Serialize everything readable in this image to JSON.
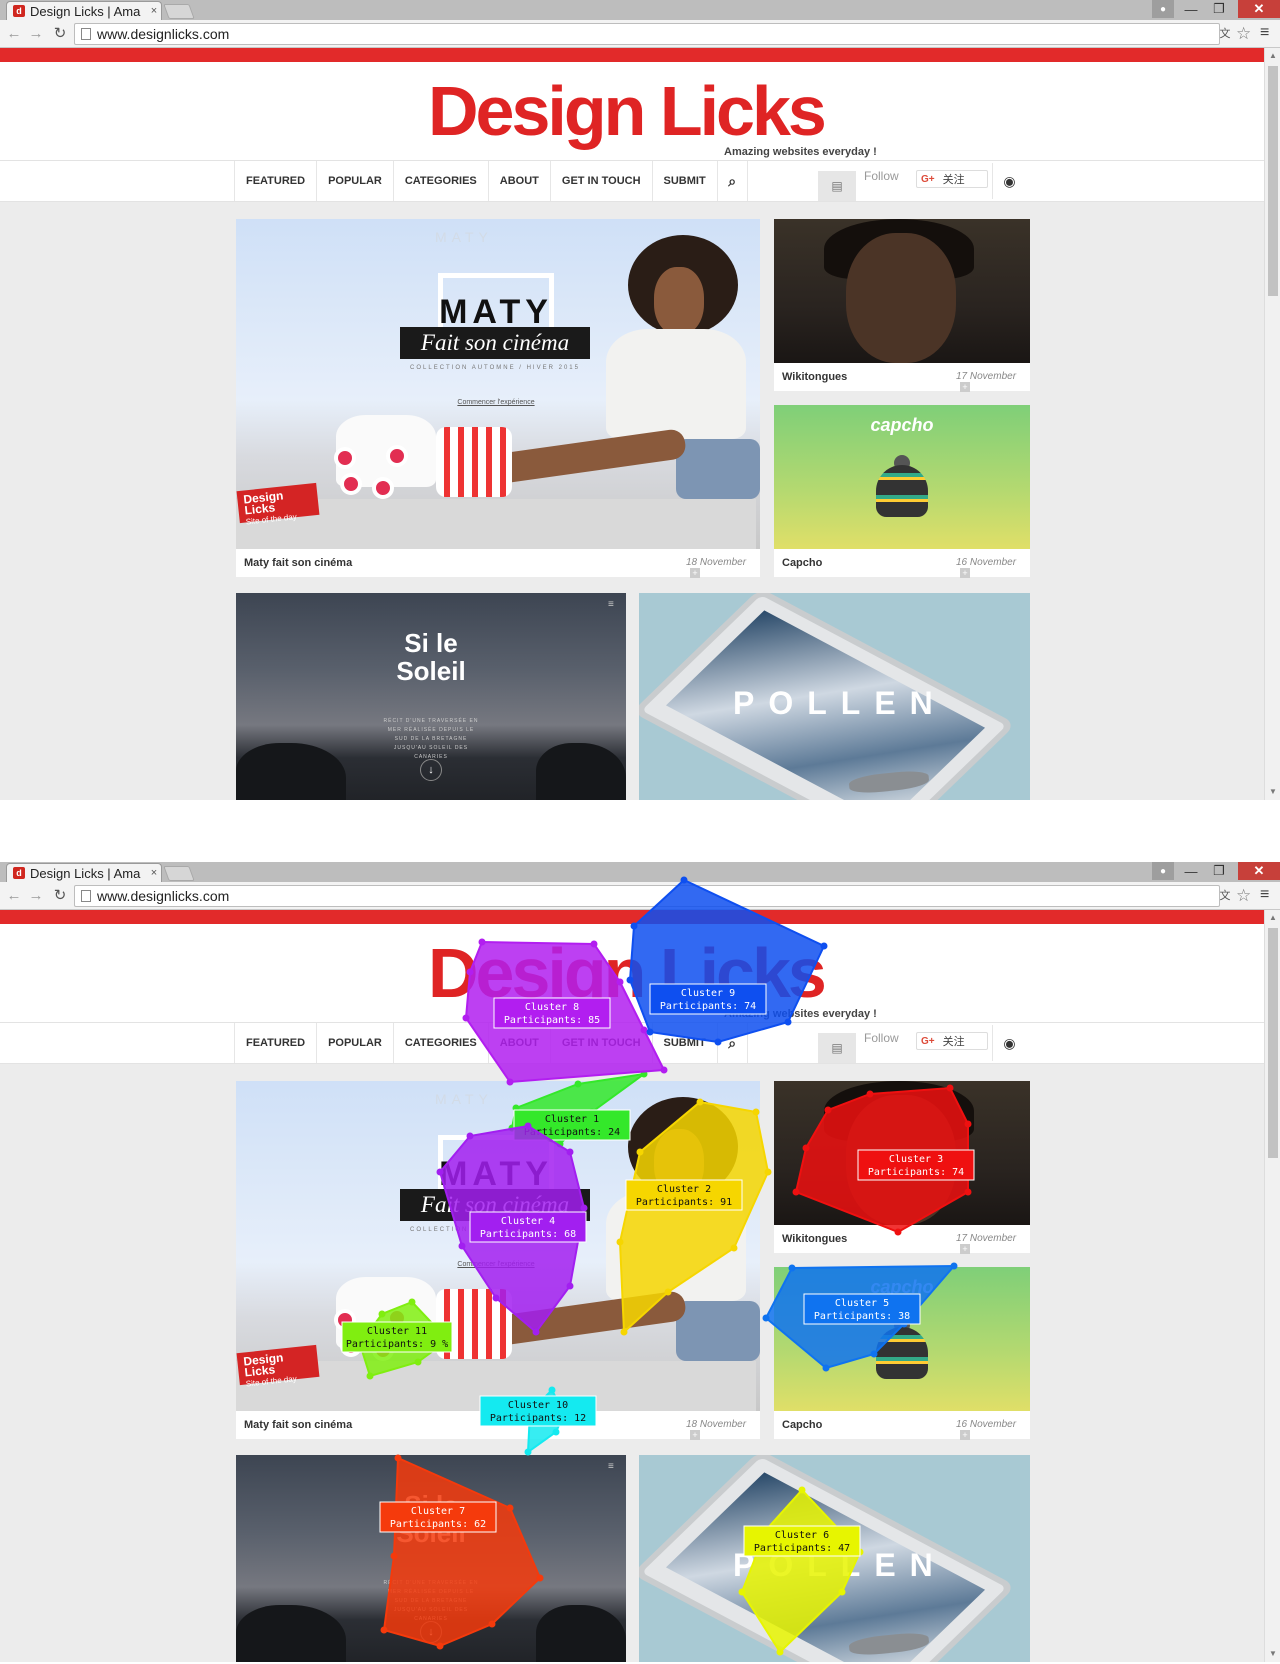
{
  "browser": {
    "tab_title": "Design Licks | Ama",
    "tab_close": "×",
    "url": "www.designlicks.com",
    "window_controls": {
      "user": "user-icon",
      "minimize": "—",
      "maximize": "❐",
      "close": "✕"
    }
  },
  "site": {
    "logo": "Design Licks",
    "tagline": "Amazing websites everyday !",
    "nav": [
      "FEATURED",
      "POPULAR",
      "CATEGORIES",
      "ABOUT",
      "GET IN TOUCH",
      "SUBMIT"
    ],
    "search_icon": "search-icon",
    "follow_label": "Follow",
    "gplus_text": "关注",
    "gplus_logo": "G+",
    "rss_icon": "rss-icon",
    "colors": {
      "brand_red": "#df2424",
      "page_bg": "#ececec"
    }
  },
  "posts": {
    "maty": {
      "caption": "Maty fait son cinéma",
      "date": "18 November",
      "brand": "MATY",
      "headline": "MATY",
      "subline": "Fait son cinéma",
      "collection": "COLLECTION AUTOMNE / HIVER 2015",
      "link": "Commencer l'expérience",
      "badge_title": "Design Licks",
      "badge_sub": "Site of the day"
    },
    "wikitongues": {
      "caption": "Wikitongues",
      "date": "17 November"
    },
    "capcho": {
      "caption": "Capcho",
      "date": "16 November",
      "logo": "capcho"
    },
    "soleil": {
      "title_line1": "Si le",
      "title_line2": "Soleil",
      "subtitle": "RÉCIT D'UNE TRAVERSÉE EN MER RÉALISÉE DEPUIS LE SUD DE LA BRETAGNE JUSQU'AU SOLEIL DES CANARIES",
      "down_arrow": "↓",
      "menu_icon": "≡"
    },
    "pollen": {
      "word": "POLLEN"
    }
  },
  "clusters": [
    {
      "label": "Cluster 1",
      "participants": "Participants: 24",
      "color": "#34e82a"
    },
    {
      "label": "Cluster 2",
      "participants": "Participants: 91",
      "color": "#f6d600"
    },
    {
      "label": "Cluster 3",
      "participants": "Participants: 74",
      "color": "#ef1010"
    },
    {
      "label": "Cluster 4",
      "participants": "Participants: 68",
      "color": "#a21ff0"
    },
    {
      "label": "Cluster 5",
      "participants": "Participants: 38",
      "color": "#0f73f0"
    },
    {
      "label": "Cluster 6",
      "participants": "Participants: 47",
      "color": "#e7f500"
    },
    {
      "label": "Cluster 7",
      "participants": "Participants: 62",
      "color": "#f53a0c"
    },
    {
      "label": "Cluster 8",
      "participants": "Participants: 85",
      "color": "#b21ef0"
    },
    {
      "label": "Cluster 9",
      "participants": "Participants: 74",
      "color": "#0e4ff0"
    },
    {
      "label": "Cluster 10",
      "participants": "Participants: 12",
      "color": "#14eaf0"
    },
    {
      "label": "Cluster 11",
      "participants": "Participants: 9 %",
      "color": "#80ee10"
    }
  ]
}
